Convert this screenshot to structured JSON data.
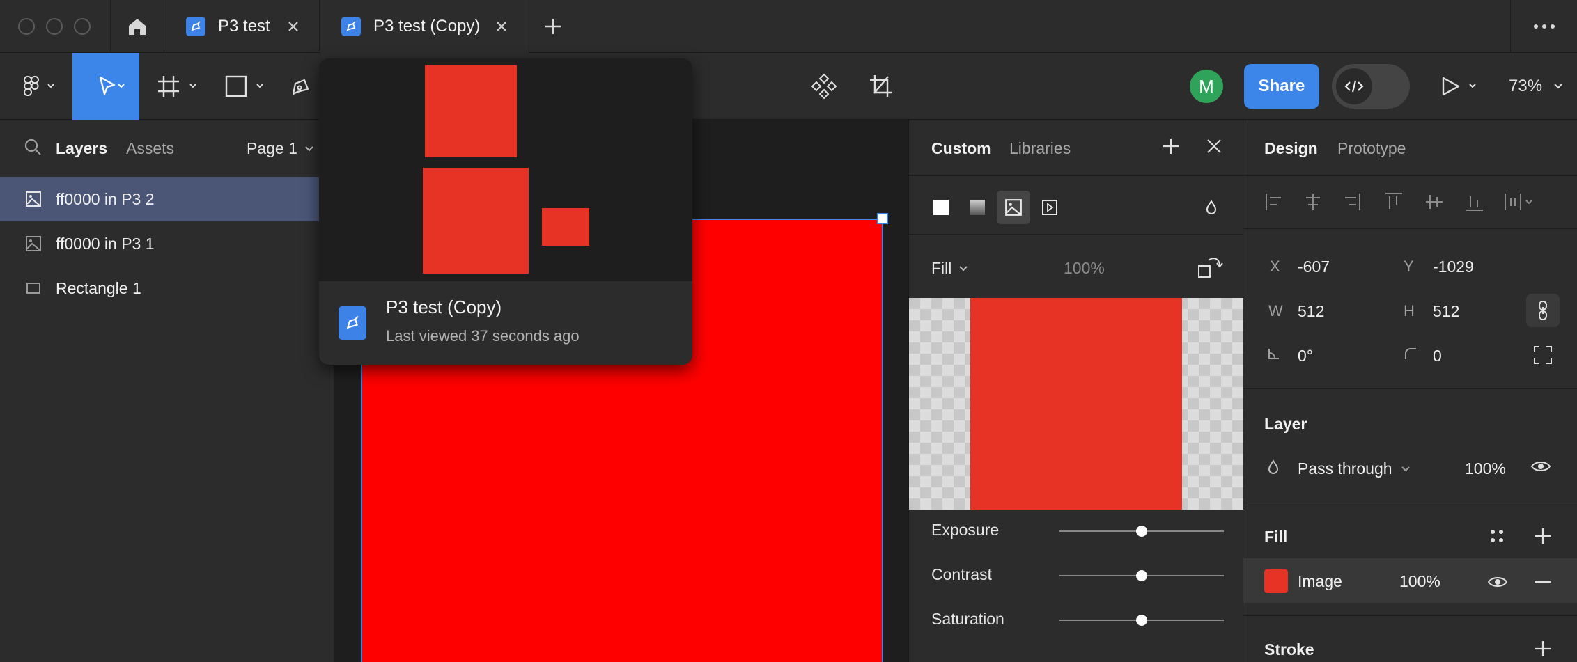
{
  "tabs": [
    {
      "label": "P3 test",
      "active": false
    },
    {
      "label": "P3 test (Copy)",
      "active": true
    }
  ],
  "toolbar": {
    "avatar_initial": "M",
    "share_label": "Share",
    "zoom": "73%"
  },
  "left_panel": {
    "tabs": [
      "Layers",
      "Assets"
    ],
    "page_selector": "Page 1",
    "layers": [
      {
        "label": "ff0000 in P3 2",
        "icon": "image-icon",
        "selected": true
      },
      {
        "label": "ff0000 in P3 1",
        "icon": "image-icon",
        "selected": false
      },
      {
        "label": "Rectangle 1",
        "icon": "rectangle-icon",
        "selected": false
      }
    ]
  },
  "tab_preview": {
    "title": "P3 test (Copy)",
    "subtitle": "Last viewed 37 seconds ago"
  },
  "fill_picker": {
    "tabs": [
      "Custom",
      "Libraries"
    ],
    "fill_type": "Fill",
    "opacity": "100%",
    "image_color": "#e63326",
    "sliders": [
      {
        "label": "Exposure",
        "value": 0.5
      },
      {
        "label": "Contrast",
        "value": 0.5
      },
      {
        "label": "Saturation",
        "value": 0.5
      }
    ]
  },
  "design_panel": {
    "tabs": [
      "Design",
      "Prototype"
    ],
    "x_key": "X",
    "x": "-607",
    "y_key": "Y",
    "y": "-1029",
    "w_key": "W",
    "w": "512",
    "h_key": "H",
    "h": "512",
    "rotation": "0°",
    "radius": "0",
    "layer_title": "Layer",
    "blend_mode": "Pass through",
    "layer_opacity": "100%",
    "fill_title": "Fill",
    "fill_label": "Image",
    "fill_opacity": "100%",
    "fill_swatch": "#e63326",
    "stroke_title": "Stroke"
  },
  "colors": {
    "accent": "#3d86e9",
    "canvas_red": "#ff0000",
    "selection_row": "#4b5677",
    "avatar": "#2fa35a"
  }
}
